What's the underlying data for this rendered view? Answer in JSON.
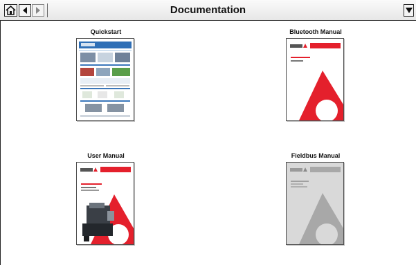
{
  "header": {
    "title": "Documentation",
    "home_icon": "home-icon",
    "back_icon": "left-arrow-icon",
    "forward_icon": "right-arrow-icon",
    "menu_icon": "dropdown-triangle-icon"
  },
  "documents": [
    {
      "label": "Quickstart"
    },
    {
      "label": "Bluetooth Manual"
    },
    {
      "label": "User Manual"
    },
    {
      "label": "Fieldbus Manual"
    }
  ],
  "colors": {
    "accent_red": "#e4202c",
    "disabled_gray": "#a8a8a8"
  }
}
